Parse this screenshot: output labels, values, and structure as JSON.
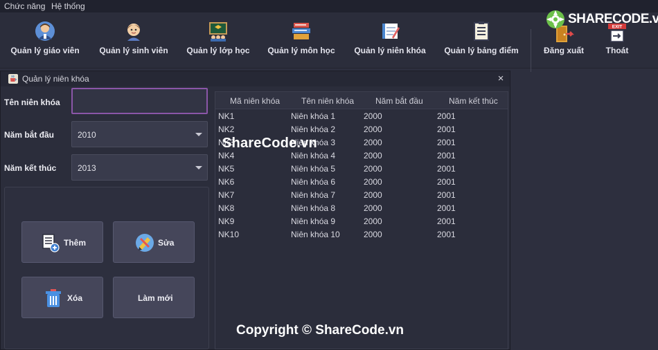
{
  "menu": [
    "Chức năng",
    "Hệ thống"
  ],
  "toolbar": [
    {
      "label": "Quản lý giáo viên",
      "icon": "teacher-icon"
    },
    {
      "label": "Quản lý sinh viên",
      "icon": "student-icon"
    },
    {
      "label": "Quản lý lớp học",
      "icon": "classroom-icon"
    },
    {
      "label": "Quản lý môn học",
      "icon": "books-icon"
    },
    {
      "label": "Quản lý niên khóa",
      "icon": "notebook-icon"
    },
    {
      "label": "Quản lý bảng điểm",
      "icon": "scoreboard-icon"
    },
    {
      "label": "Đăng xuất",
      "icon": "logout-icon"
    },
    {
      "label": "Thoát",
      "icon": "exit-icon"
    }
  ],
  "logo": {
    "text": "SHARECODE.vn"
  },
  "window": {
    "title": "Quản lý niên khóa",
    "close": "×"
  },
  "form": {
    "name_label": "Tên niên khóa",
    "name_value": "",
    "start_label": "Năm bắt đầu",
    "start_value": "2010",
    "end_label": "Năm kết thúc",
    "end_value": "2013"
  },
  "buttons": {
    "add": "Thêm",
    "edit": "Sửa",
    "delete": "Xóa",
    "refresh": "Làm mới"
  },
  "table": {
    "headers": [
      "Mã niên khóa",
      "Tên niên khóa",
      "Năm bắt đầu",
      "Năm kết thúc"
    ],
    "rows": [
      [
        "NK1",
        "Niên khóa 1",
        "2000",
        "2001"
      ],
      [
        "NK2",
        "Niên khóa 2",
        "2000",
        "2001"
      ],
      [
        "NK3",
        "Niên khóa 3",
        "2000",
        "2001"
      ],
      [
        "NK4",
        "Niên khóa 4",
        "2000",
        "2001"
      ],
      [
        "NK5",
        "Niên khóa 5",
        "2000",
        "2001"
      ],
      [
        "NK6",
        "Niên khóa 6",
        "2000",
        "2001"
      ],
      [
        "NK7",
        "Niên khóa 7",
        "2000",
        "2001"
      ],
      [
        "NK8",
        "Niên khóa 8",
        "2000",
        "2001"
      ],
      [
        "NK9",
        "Niên khóa 9",
        "2000",
        "2001"
      ],
      [
        "NK10",
        "Niên khóa 10",
        "2000",
        "2001"
      ]
    ]
  },
  "watermark": {
    "center": "ShareCode.vn",
    "bottom": "Copyright © ShareCode.vn"
  }
}
